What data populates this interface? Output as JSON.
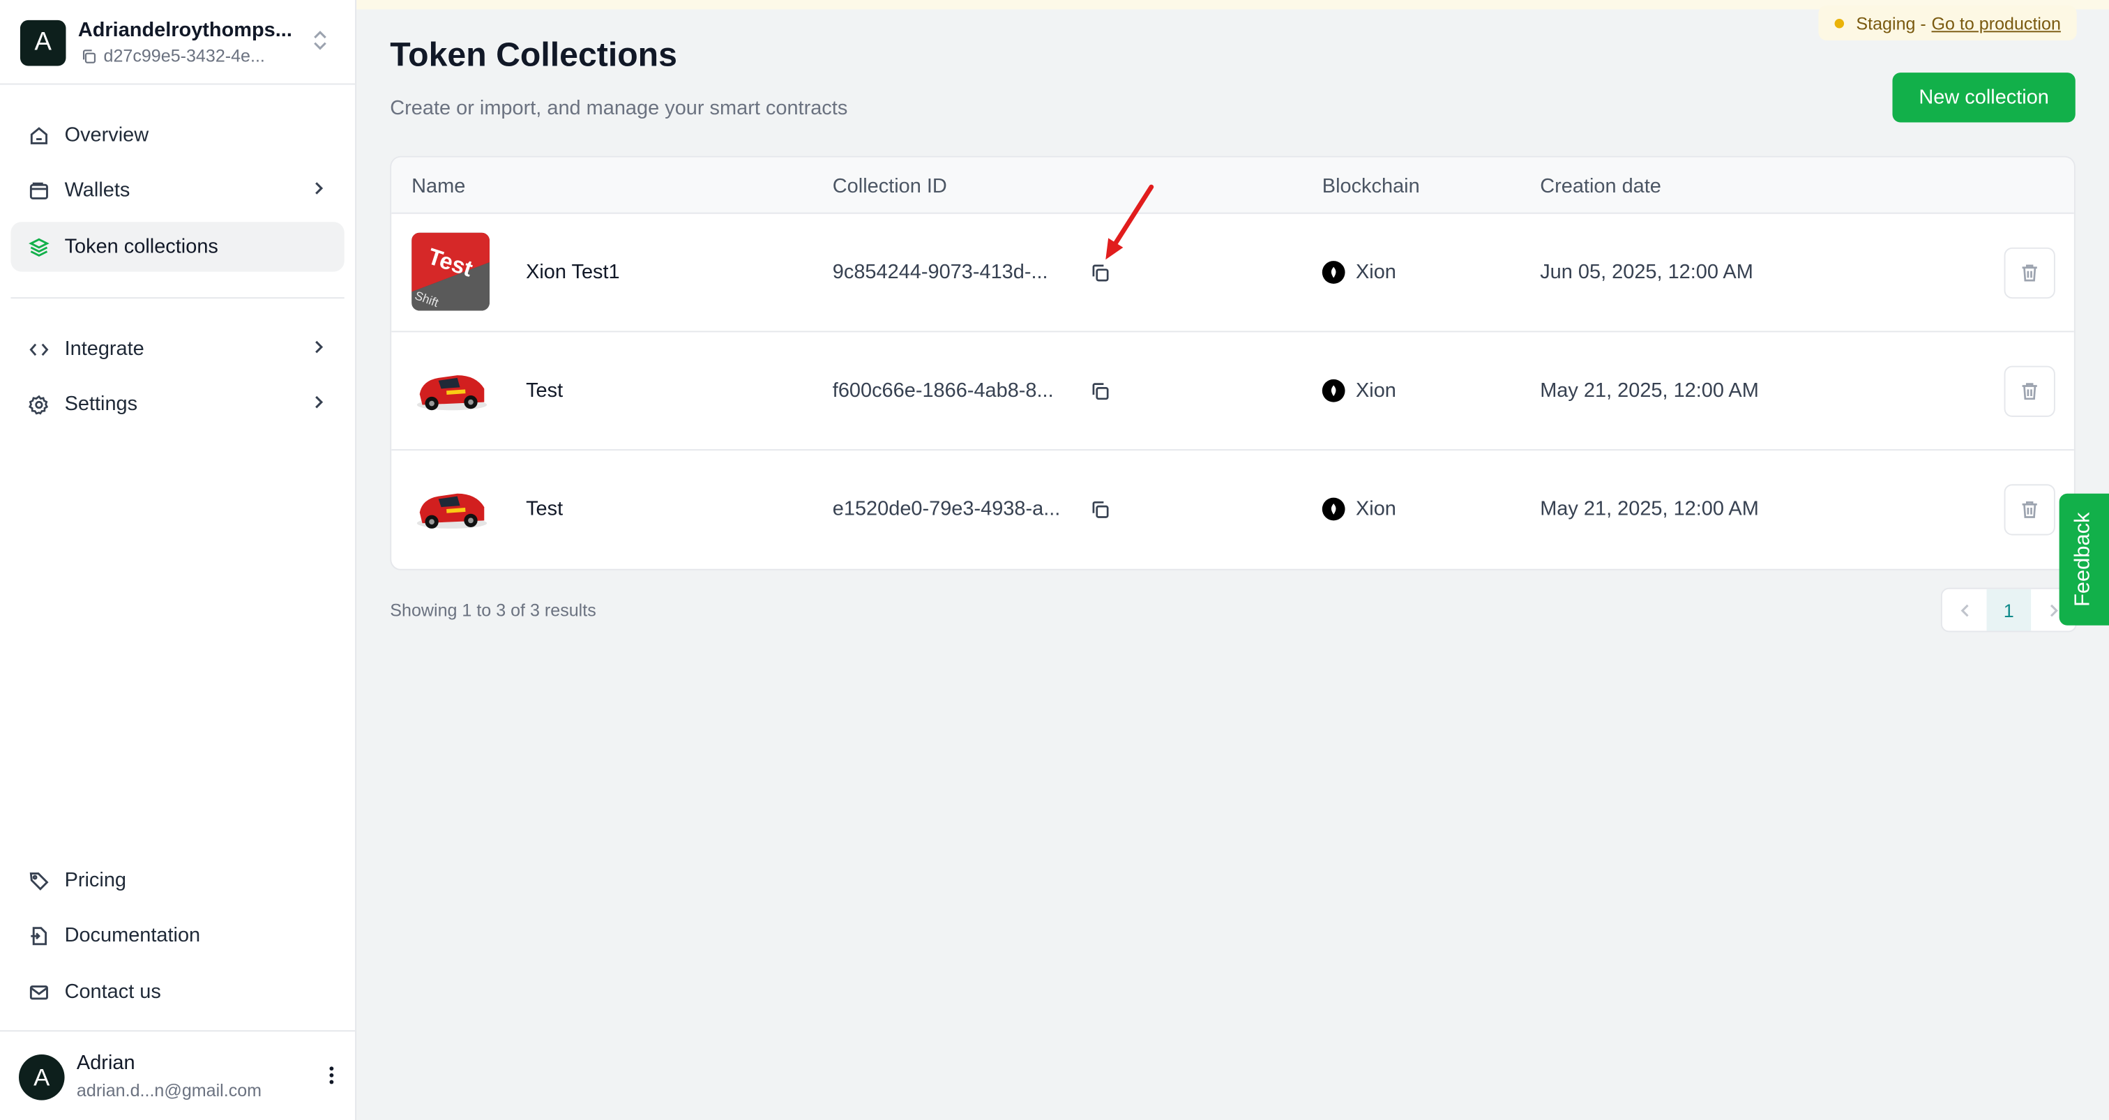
{
  "org": {
    "avatar_letter": "A",
    "name": "Adriandelroythomps...",
    "id": "d27c99e5-3432-4e..."
  },
  "nav": {
    "overview": "Overview",
    "wallets": "Wallets",
    "token_collections": "Token collections",
    "integrate": "Integrate",
    "settings": "Settings",
    "pricing": "Pricing",
    "documentation": "Documentation",
    "contact": "Contact us"
  },
  "user": {
    "avatar_letter": "A",
    "name": "Adrian",
    "email": "adrian.d...n@gmail.com"
  },
  "env": {
    "label": "Staging -",
    "link": "Go to production"
  },
  "page": {
    "title": "Token Collections",
    "subtitle": "Create or import, and manage your smart contracts",
    "new_button": "New collection"
  },
  "table": {
    "headers": {
      "name": "Name",
      "collection_id": "Collection ID",
      "blockchain": "Blockchain",
      "creation_date": "Creation date"
    },
    "rows": [
      {
        "name": "Xion Test1",
        "collection_id": "9c854244-9073-413d-...",
        "blockchain": "Xion",
        "date": "Jun 05, 2025, 12:00 AM",
        "thumb_text": "Test",
        "thumb_sub": "Shift"
      },
      {
        "name": "Test",
        "collection_id": "f600c66e-1866-4ab8-8...",
        "blockchain": "Xion",
        "date": "May 21, 2025, 12:00 AM"
      },
      {
        "name": "Test",
        "collection_id": "e1520de0-79e3-4938-a...",
        "blockchain": "Xion",
        "date": "May 21, 2025, 12:00 AM"
      }
    ]
  },
  "pagination": {
    "summary": "Showing 1 to 3 of 3 results",
    "current": "1"
  },
  "feedback": "Feedback",
  "colors": {
    "accent": "#12b04a",
    "annotation_arrow": "#e11d1d"
  }
}
